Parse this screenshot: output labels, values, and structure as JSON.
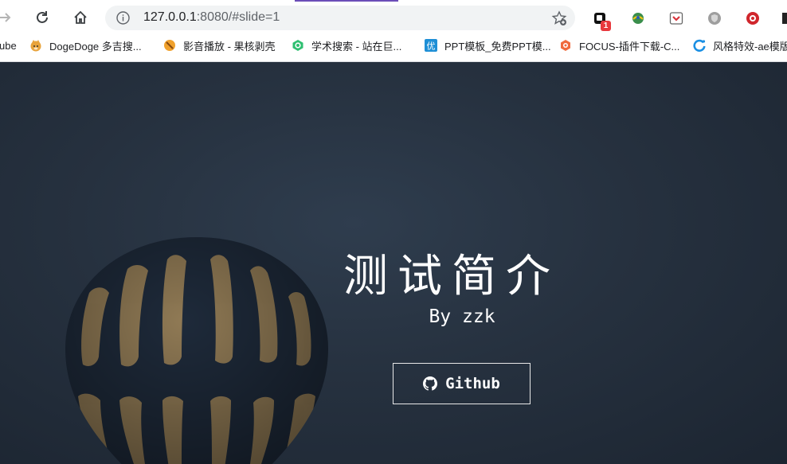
{
  "browser": {
    "url_host": "127.0.0.1",
    "url_path": ":8080/#slide=1",
    "extension_badge": "1"
  },
  "bookmarks": [
    {
      "label": "ube"
    },
    {
      "label": "DogeDoge 多吉搜..."
    },
    {
      "label": "影音播放 - 果核剥壳"
    },
    {
      "label": "学术搜索 - 站在巨..."
    },
    {
      "label": "PPT模板_免费PPT模..."
    },
    {
      "label": "FOCUS-插件下载-C..."
    },
    {
      "label": "风格特效-ae模版"
    }
  ],
  "slide": {
    "title": "测试简介",
    "subtitle": "By zzk",
    "button_label": "Github"
  },
  "colors": {
    "slide_bg": "#26313f",
    "balloon_stripe_dark": "#1e2a3a",
    "balloon_stripe_light": "#a4885a",
    "accent_tab": "#6c4db8"
  }
}
